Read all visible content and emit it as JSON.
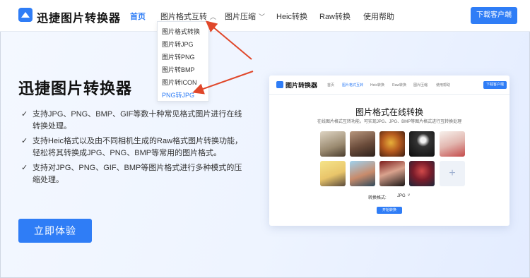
{
  "app": {
    "brand": "迅捷图片转换器"
  },
  "nav": {
    "items": [
      {
        "label": "首页",
        "active": true
      },
      {
        "label": "图片格式互转",
        "caret": "^"
      },
      {
        "label": "图片压缩",
        "caret": "v"
      },
      {
        "label": "Heic转换"
      },
      {
        "label": "Raw转换"
      },
      {
        "label": "使用帮助"
      }
    ],
    "download_label": "下载客户端"
  },
  "dropdown": {
    "items": [
      "图片格式转换",
      "图片转JPG",
      "图片转PNG",
      "图片转BMP",
      "图片转ICON",
      "PNG转JPG"
    ],
    "selected": "PNG转JPG"
  },
  "hero": {
    "title": "迅捷图片转换器",
    "features": [
      "支持JPG、PNG、BMP、GIF等数十种常见格式图片进行在线转换处理。",
      "支持Heic格式以及由不同相机生成的Raw格式图片转换功能，轻松将其转换成JPG、PNG、BMP等常用的图片格式。",
      "支持对JPG、PNG、GIF、BMP等图片格式进行多种模式的压缩处理。"
    ],
    "check_icon": "✓",
    "cta_label": "立即体验"
  },
  "preview": {
    "brand": "图片转换器",
    "nav": [
      "首页",
      "图片格式互转",
      "Heic转换",
      "Raw转换",
      "图片压缩",
      "使用帮助"
    ],
    "download_label": "下载客户端",
    "title": "图片格式在线转换",
    "subtitle": "在线图片格式互转功能，可实现JPG、JPG、BMP等图片格式进行互转换处理",
    "add_icon": "+",
    "format_label": "转换格式:",
    "format_value": "JPG",
    "format_caret": "v",
    "start_label": "开始转换"
  },
  "colors": {
    "accent": "#2f7df6",
    "arrow": "#e0472a"
  }
}
